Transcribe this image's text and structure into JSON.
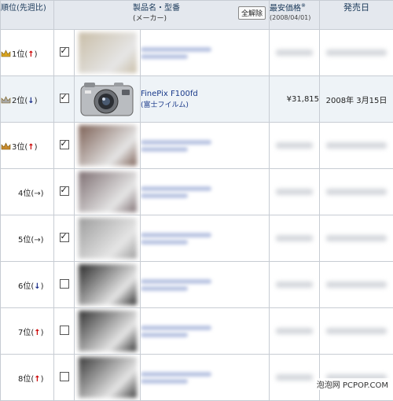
{
  "header": {
    "rank_label": "順位(先週比)",
    "product_label": "製品名・型番",
    "maker_label": "(メーカー)",
    "clear_button": "全解除",
    "price_label": "最安価格",
    "price_mark": "※",
    "price_date": "(2008/04/01)",
    "release_label": "発売日"
  },
  "rows": [
    {
      "rank": "1位",
      "trend": "↑",
      "trend_type": "up",
      "crown": "gold",
      "checked": true,
      "thumb_color": "#c9bea8"
    },
    {
      "rank": "2位",
      "trend": "↓",
      "trend_type": "down",
      "crown": "silver",
      "checked": true,
      "product_name": "FinePix F100fd",
      "maker": "(富士フイルム)",
      "price": "¥31,815",
      "release": "2008年 3月15日"
    },
    {
      "rank": "3位",
      "trend": "↑",
      "trend_type": "up",
      "crown": "bronze",
      "checked": true,
      "thumb_color": "#7d6156"
    },
    {
      "rank": "4位",
      "trend": "→",
      "trend_type": "flat",
      "crown": "",
      "checked": true,
      "thumb_color": "#7e6f72"
    },
    {
      "rank": "5位",
      "trend": "→",
      "trend_type": "flat",
      "crown": "",
      "checked": true,
      "thumb_color": "#9c9c9c"
    },
    {
      "rank": "6位",
      "trend": "↓",
      "trend_type": "down",
      "crown": "",
      "checked": false,
      "thumb_color": "#2a2a2a"
    },
    {
      "rank": "7位",
      "trend": "↑",
      "trend_type": "up",
      "crown": "",
      "checked": false,
      "thumb_color": "#333333"
    },
    {
      "rank": "8位",
      "trend": "↑",
      "trend_type": "up",
      "crown": "",
      "checked": false,
      "thumb_color": "#3b3b3b"
    }
  ],
  "watermark": "泡泡网 PCPOP.COM",
  "colors": {
    "gold": "#d9a520",
    "silver": "#a9a9a9",
    "bronze": "#c88a2e",
    "link": "#1a3a8a",
    "up": "#cc0000",
    "down": "#1b2f8a"
  }
}
